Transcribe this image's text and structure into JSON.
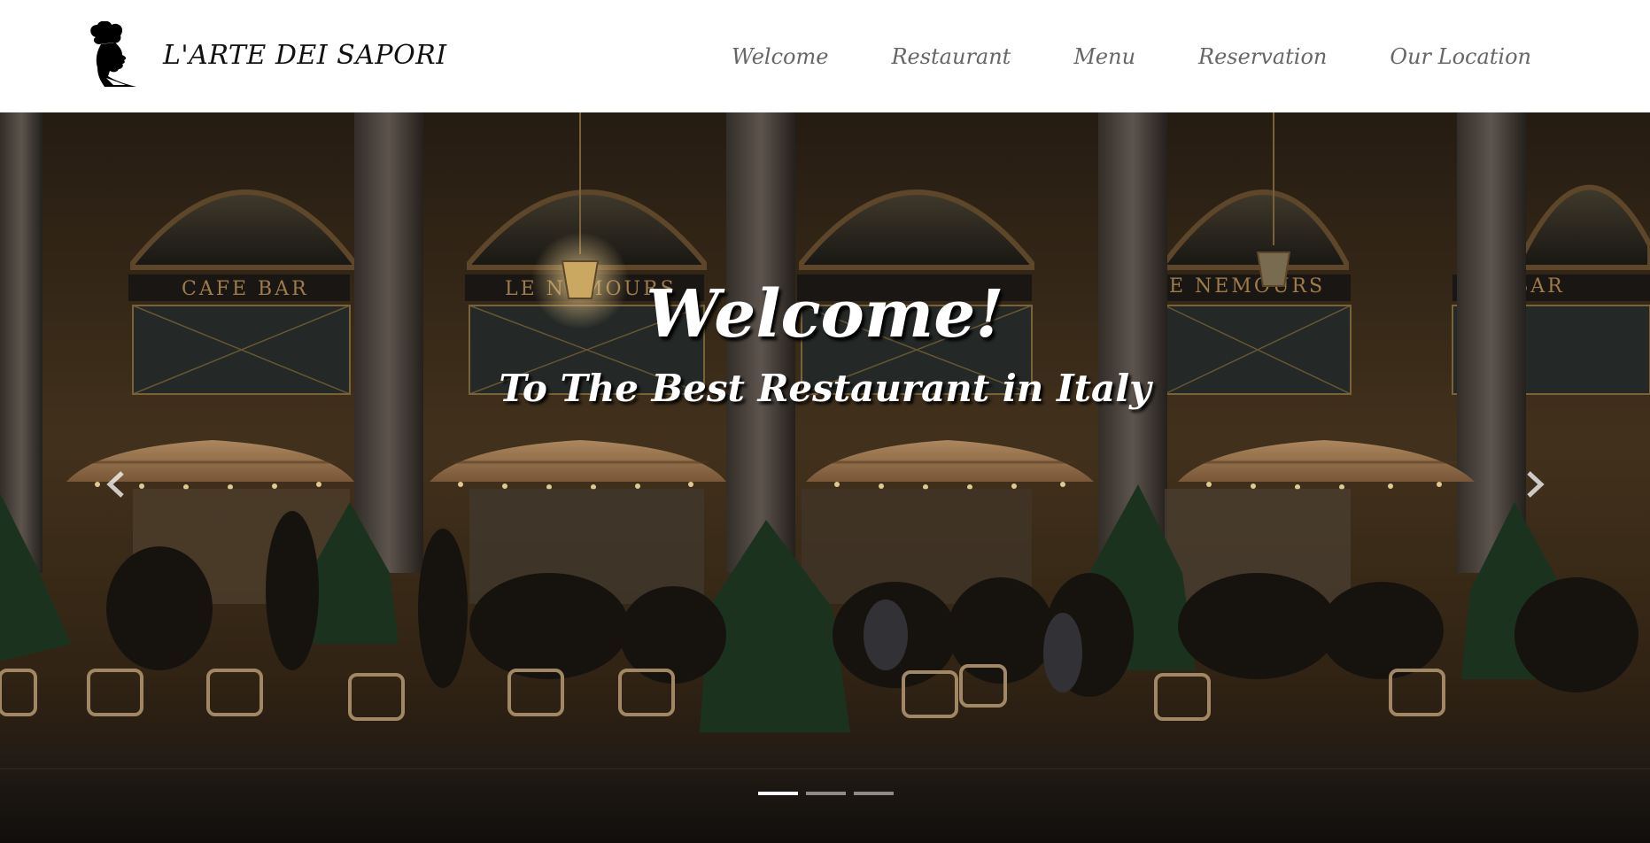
{
  "brand": {
    "name": "L'ARTE DEI SAPORI",
    "logo_icon": "chef-silhouette-icon"
  },
  "nav": {
    "items": [
      {
        "label": "Welcome"
      },
      {
        "label": "Restaurant"
      },
      {
        "label": "Menu"
      },
      {
        "label": "Reservation"
      },
      {
        "label": "Our Location"
      }
    ]
  },
  "hero": {
    "title": "Welcome!",
    "subtitle": "To The Best Restaurant in Italy",
    "signs": [
      "CAFE  BAR",
      "LE NEMOURS",
      "E NEMOURS",
      "E  BAR"
    ],
    "prev_icon": "chevron-left-icon",
    "next_icon": "chevron-right-icon",
    "slides": [
      {
        "active": true
      },
      {
        "active": false
      },
      {
        "active": false
      }
    ]
  },
  "colors": {
    "nav_text": "#666666",
    "brand_text": "#111111",
    "hero_text": "#ffffff",
    "indicator_active": "#ffffff",
    "indicator_inactive": "#9a9a9a"
  }
}
